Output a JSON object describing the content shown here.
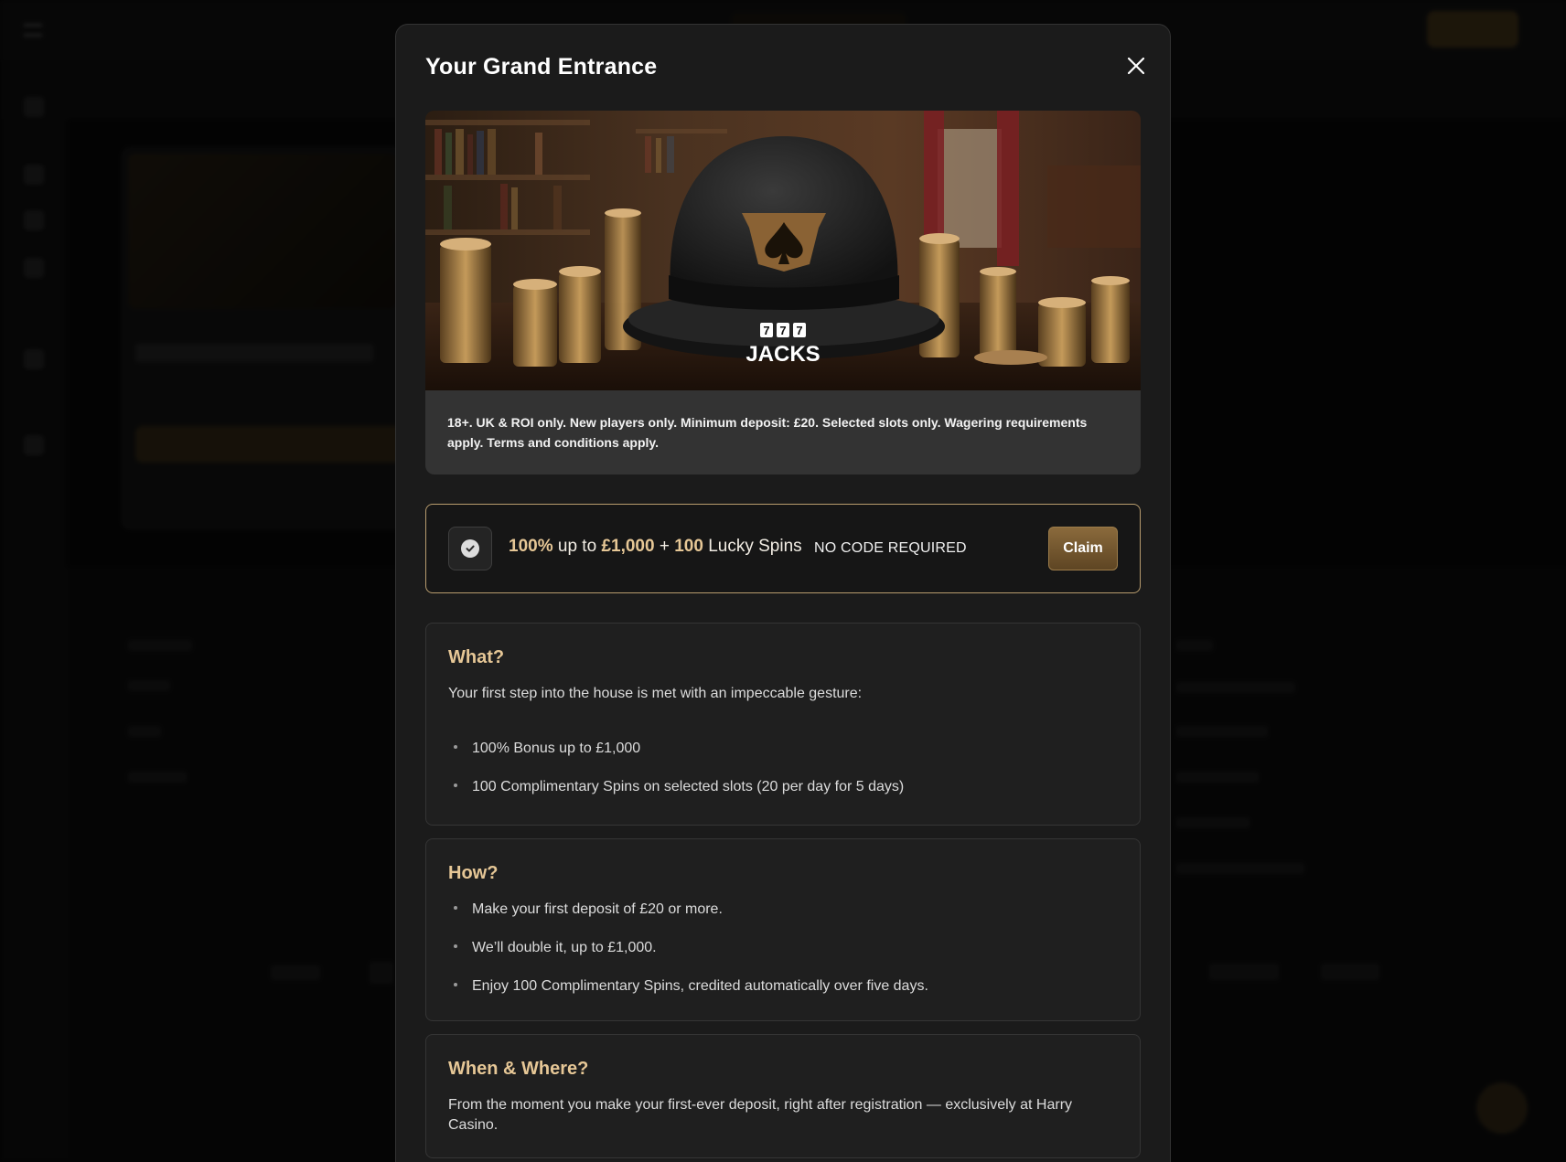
{
  "modal": {
    "title": "Your Grand Entrance",
    "hero_logo_top": "777",
    "hero_logo_bottom": "JACKS",
    "disclaimer": "18+. UK & ROI only. New players only. Minimum deposit: £20. Selected slots only. Wagering requirements apply. Terms and conditions apply."
  },
  "offer": {
    "pct": "100%",
    "up_to": "up to",
    "amount": "£1,000",
    "plus": "+",
    "spins_count": "100",
    "spins_label": "Lucky Spins",
    "no_code": "NO CODE REQUIRED",
    "claim_label": "Claim"
  },
  "sections": {
    "what": {
      "title": "What?",
      "intro": "Your first step into the house is met with an impeccable gesture:",
      "items": [
        "100% Bonus up to £1,000",
        "100 Complimentary Spins on selected slots (20 per day for 5 days)"
      ]
    },
    "how": {
      "title": "How?",
      "items": [
        "Make your first deposit of £20 or more.",
        "We’ll double it, up to £1,000.",
        "Enjoy 100 Complimentary Spins, credited automatically over five days."
      ]
    },
    "when": {
      "title": "When & Where?",
      "text": "From the moment you make your first-ever deposit, right after registration — exclusively at Harry Casino."
    }
  },
  "icons": {
    "close": "close-icon",
    "check": "check-circle-icon"
  },
  "colors": {
    "accent_gold": "#e6c796",
    "claim_button": "#7a5a30",
    "modal_bg": "#1b1b1b"
  }
}
